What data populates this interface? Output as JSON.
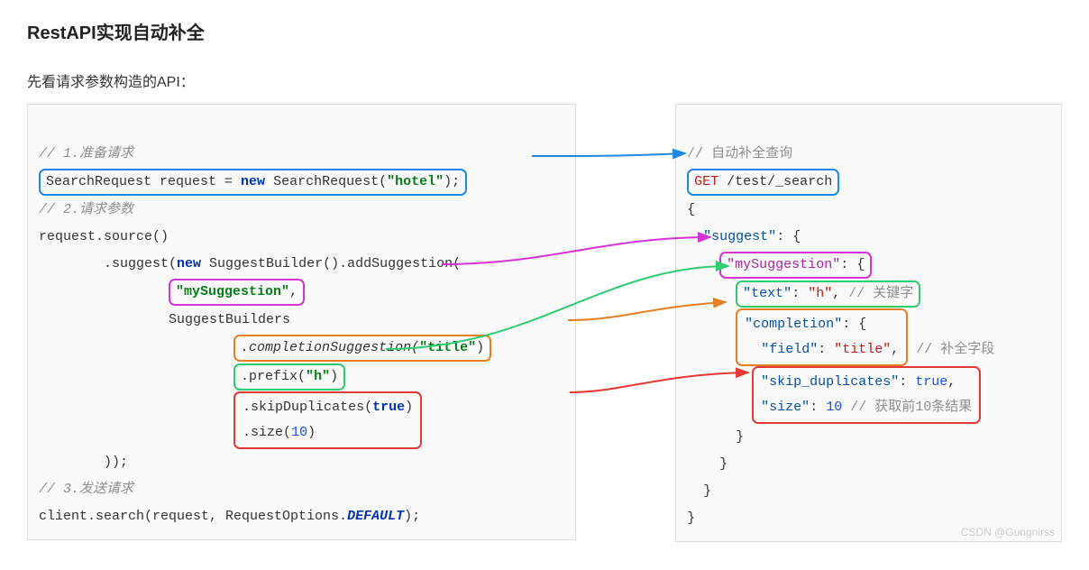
{
  "title": "RestAPI实现自动补全",
  "subtitle": "先看请求参数构造的API：",
  "left": {
    "c1": "// 1.准备请求",
    "l1a": "SearchRequest request = ",
    "l1_new": "new",
    "l1b": " SearchRequest(",
    "l1_hotel": "\"hotel\"",
    "l1c": ");",
    "c2": "// 2.请求参数",
    "l2": "request.source()",
    "l3a": "        .suggest(",
    "l3_new": "new",
    "l3b": " SuggestBuilder().addSuggestion(",
    "l4": "\"mySuggestion\"",
    "l4b": ",",
    "l5": "                SuggestBuilders",
    "l6a": ".completionSuggestion(",
    "l6_title": "\"title\"",
    "l6b": ")",
    "l7a": ".prefix(",
    "l7_h": "\"h\"",
    "l7b": ")",
    "l8a": ".skipDuplicates(",
    "l8_true": "true",
    "l8b": ")",
    "l9a": ".size(",
    "l9_10": "10",
    "l9b": ")",
    "l10": "        ));",
    "c3": "// 3.发送请求",
    "l11a": "client.search(request, RequestOptions.",
    "l11_def": "DEFAULT",
    "l11b": ");"
  },
  "right": {
    "c1": "// 自动补全查询",
    "l1a": "GET",
    "l1b": " /test/_search",
    "l2": "{",
    "l3a": "  ",
    "l3_key": "\"suggest\"",
    "l3b": ": {",
    "l4_key": "\"mySuggestion\"",
    "l4b": ": {",
    "l5_text": "\"text\"",
    "l5b": ": ",
    "l5_h": "\"h\"",
    "l5c": ", ",
    "l5_cmt": "// 关键字",
    "l6_comp": "\"completion\"",
    "l6b": ": {",
    "l7_field": "\"field\"",
    "l7b": ": ",
    "l7_title": "\"title\"",
    "l7c": ",",
    "l7_cmt": "// 补全字段",
    "l8_skip": "\"skip_duplicates\"",
    "l8b": ": ",
    "l8_true": "true",
    "l8c": ",",
    "l9_size": "\"size\"",
    "l9b": ": ",
    "l9_10": "10",
    "l9_cmt": " // 获取前10条结果",
    "l10": "      }",
    "l11": "    }",
    "l12": "  }",
    "l13": "}"
  },
  "watermark": "CSDN @Gungnirss"
}
